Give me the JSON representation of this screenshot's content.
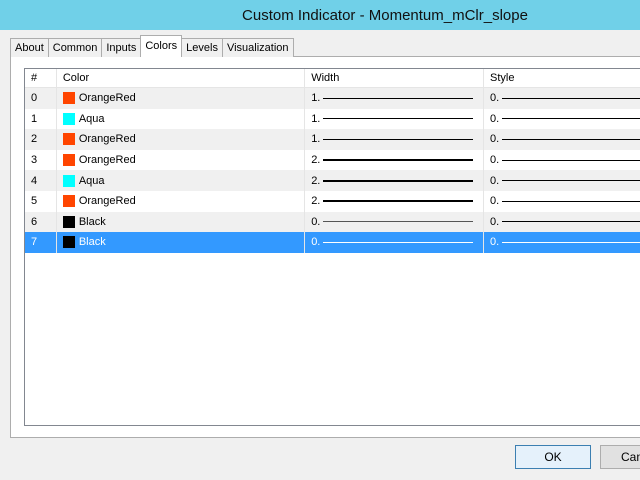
{
  "window": {
    "title": "Custom Indicator - Momentum_mClr_slope"
  },
  "tabs": [
    {
      "label": "About"
    },
    {
      "label": "Common"
    },
    {
      "label": "Inputs"
    },
    {
      "label": "Colors",
      "active": true
    },
    {
      "label": "Levels"
    },
    {
      "label": "Visualization"
    }
  ],
  "table": {
    "headers": {
      "num": "#",
      "color": "Color",
      "width": "Width",
      "style": "Style"
    },
    "rows": [
      {
        "num": "0",
        "color_name": "OrangeRed",
        "swatch": "#ff4500",
        "width": "1.",
        "style": "0."
      },
      {
        "num": "1",
        "color_name": "Aqua",
        "swatch": "#00ffff",
        "width": "1.",
        "style": "0."
      },
      {
        "num": "2",
        "color_name": "OrangeRed",
        "swatch": "#ff4500",
        "width": "1.",
        "style": "0."
      },
      {
        "num": "3",
        "color_name": "OrangeRed",
        "swatch": "#ff4500",
        "width": "2.",
        "style": "0."
      },
      {
        "num": "4",
        "color_name": "Aqua",
        "swatch": "#00ffff",
        "width": "2.",
        "style": "0."
      },
      {
        "num": "5",
        "color_name": "OrangeRed",
        "swatch": "#ff4500",
        "width": "2.",
        "style": "0."
      },
      {
        "num": "6",
        "color_name": "Black",
        "swatch": "#000000",
        "width": "0.",
        "style": "0."
      },
      {
        "num": "7",
        "color_name": "Black",
        "swatch": "#000000",
        "width": "0.",
        "style": "0.",
        "selected": true
      }
    ]
  },
  "buttons": {
    "ok": "OK",
    "cancel": "Cancel"
  },
  "colors": {
    "selection": "#3399ff",
    "titlebar": "#70d0e8"
  }
}
